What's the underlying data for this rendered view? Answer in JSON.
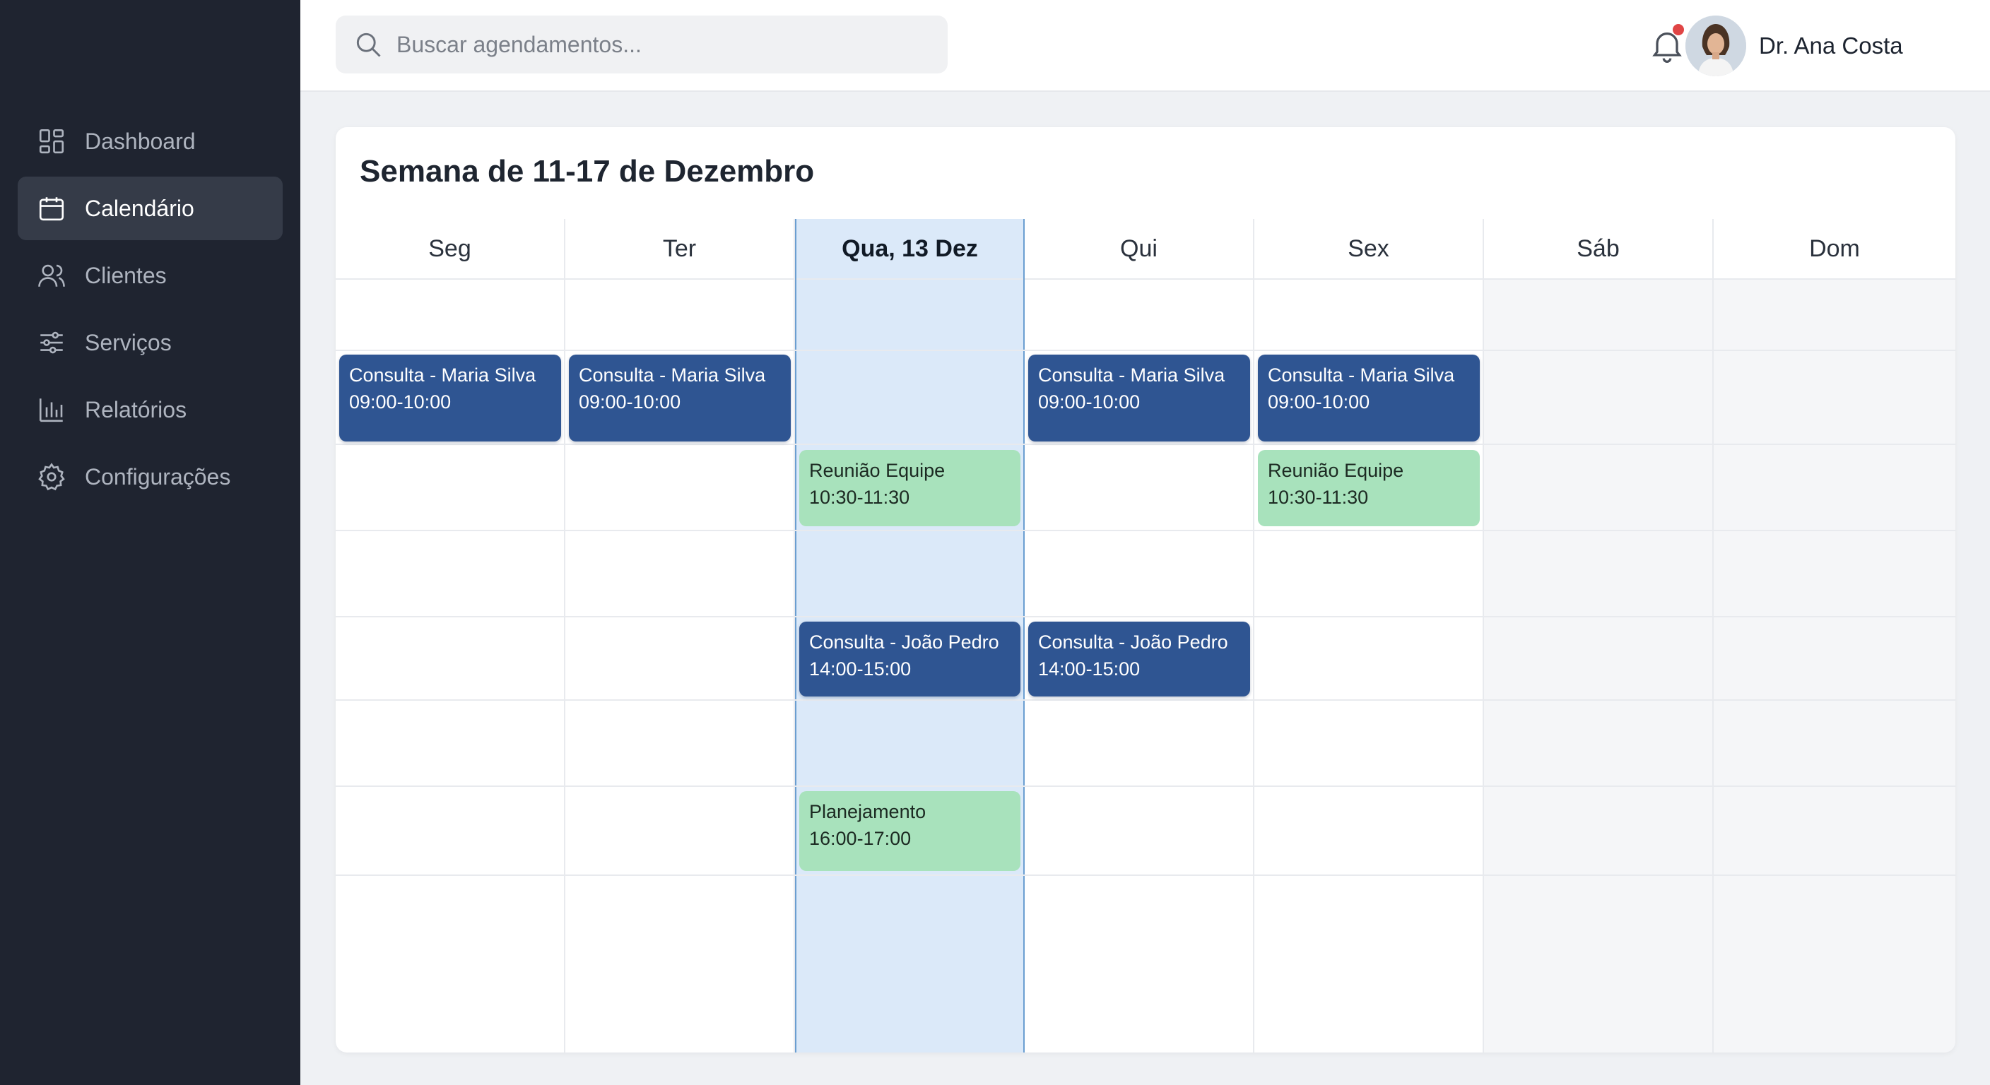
{
  "sidebar": {
    "items": [
      {
        "label": "Dashboard",
        "icon": "dashboard-icon",
        "active": false
      },
      {
        "label": "Calendário",
        "icon": "calendar-icon",
        "active": true
      },
      {
        "label": "Clientes",
        "icon": "users-icon",
        "active": false
      },
      {
        "label": "Serviços",
        "icon": "sliders-icon",
        "active": false
      },
      {
        "label": "Relatórios",
        "icon": "bar-chart-icon",
        "active": false
      },
      {
        "label": "Configurações",
        "icon": "gear-icon",
        "active": false
      }
    ]
  },
  "topbar": {
    "search_placeholder": "Buscar agendamentos...",
    "user_name": "Dr. Ana Costa",
    "has_notification": true
  },
  "calendar": {
    "title": "Semana de 11-17 de Dezembro",
    "days": [
      {
        "label": "Seg",
        "today": false,
        "weekend": false
      },
      {
        "label": "Ter",
        "today": false,
        "weekend": false
      },
      {
        "label": "Qua, 13 Dez",
        "today": true,
        "weekend": false
      },
      {
        "label": "Qui",
        "today": false,
        "weekend": false
      },
      {
        "label": "Sex",
        "today": false,
        "weekend": false
      },
      {
        "label": "Sáb",
        "today": false,
        "weekend": true
      },
      {
        "label": "Dom",
        "today": false,
        "weekend": true
      }
    ],
    "events": {
      "e1": {
        "title": "Consulta - Maria Silva",
        "time": "09:00-10:00"
      },
      "e2": {
        "title": "Consulta - Maria Silva",
        "time": "09:00-10:00"
      },
      "e3": {
        "title": "Consulta - Maria Silva",
        "time": "09:00-10:00"
      },
      "e4": {
        "title": "Consulta - Maria Silva",
        "time": "09:00-10:00"
      },
      "e5": {
        "title": "Reunião Equipe",
        "time": "10:30-11:30"
      },
      "e6": {
        "title": "Reunião Equipe",
        "time": "10:30-11:30"
      },
      "e7": {
        "title": "Consulta - João Pedro",
        "time": "14:00-15:00"
      },
      "e8": {
        "title": "Consulta - João Pedro",
        "time": "14:00-15:00"
      },
      "e9": {
        "title": "Planejamento",
        "time": "16:00-17:00"
      }
    }
  },
  "colors": {
    "sidebar_bg": "#1f2430",
    "event_blue": "#2f5592",
    "event_green": "#a8e2bc",
    "today_bg": "#dbe9f9",
    "notification_dot": "#e04545"
  }
}
